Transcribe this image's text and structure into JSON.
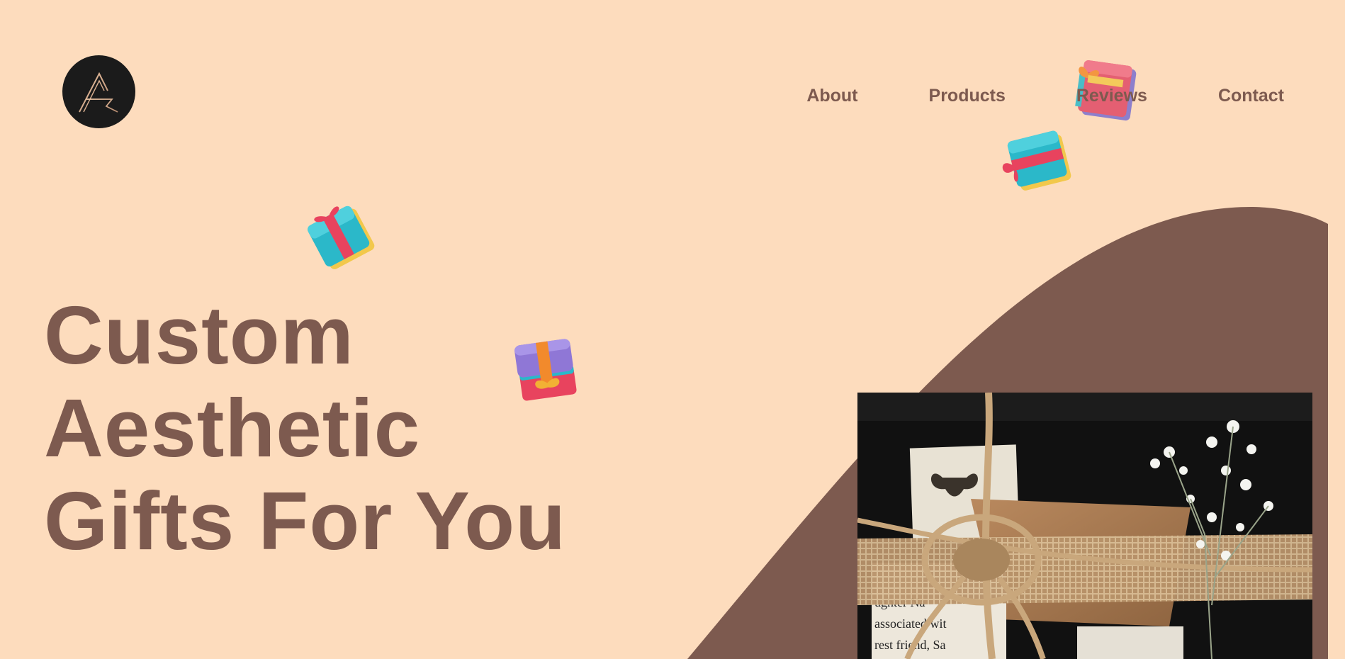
{
  "brand": {
    "logo_icon": "stylized-a-monogram-icon"
  },
  "nav": {
    "items": [
      {
        "label": "About"
      },
      {
        "label": "Products"
      },
      {
        "label": "Reviews"
      },
      {
        "label": "Contact"
      }
    ]
  },
  "hero": {
    "title_line_1": "Custom",
    "title_line_2": "Aesthetic",
    "title_line_3": "Gifts For You"
  },
  "decorations": {
    "gift_icons": [
      "gift-box-icon",
      "gift-box-icon",
      "gift-box-icon",
      "gift-box-icon"
    ]
  },
  "product_image": {
    "snippet_line_1": "ughter Na",
    "snippet_line_2": "associated wit",
    "snippet_line_3": "rest friend, Sa"
  },
  "colors": {
    "background": "#fddcbd",
    "accent_brown": "#7d5a4f",
    "logo_bg": "#1b1b1b"
  }
}
